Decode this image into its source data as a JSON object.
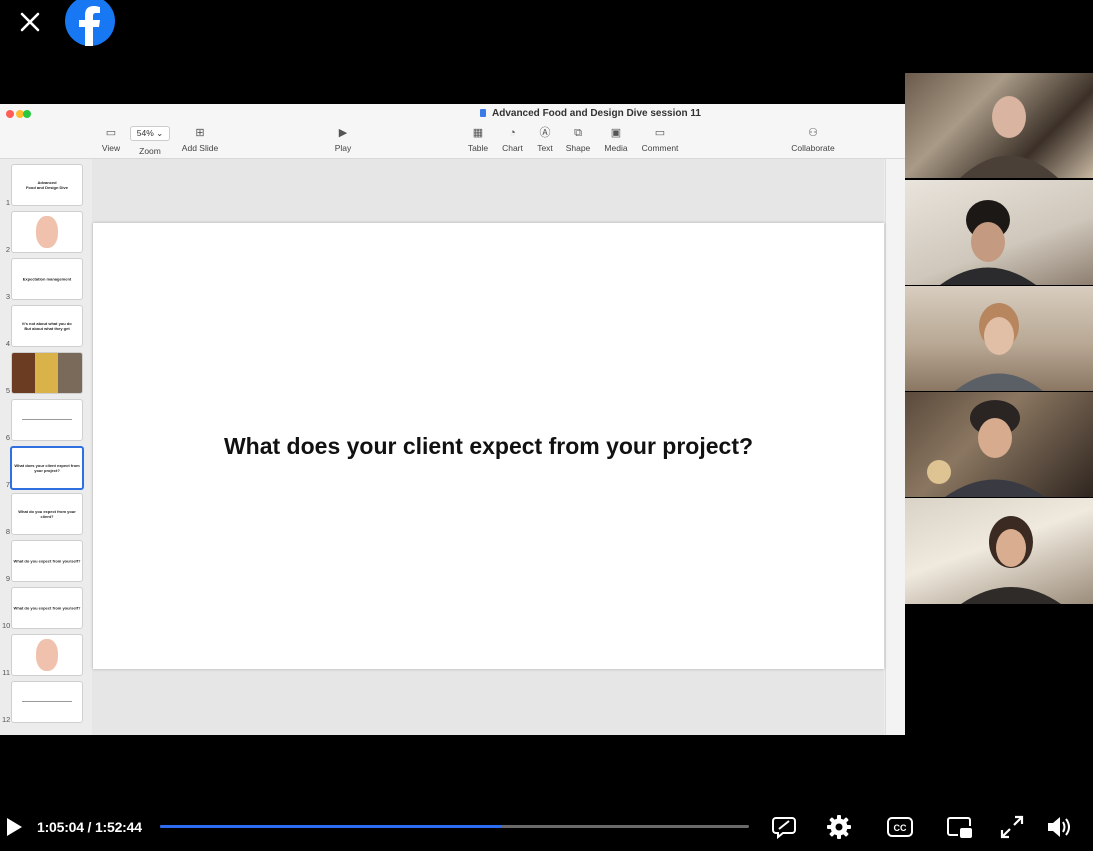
{
  "app": {
    "document_title": "Advanced Food and Design Dive session 11",
    "zoom": "54%",
    "toolbar": [
      {
        "name": "view",
        "label": "View",
        "icon": "sidebar-icon"
      },
      {
        "name": "zoom",
        "label": "Zoom",
        "icon": "zoom-icon"
      },
      {
        "name": "add-slide",
        "label": "Add Slide",
        "icon": "add-slide-icon"
      },
      {
        "name": "play",
        "label": "Play",
        "icon": "play-icon"
      },
      {
        "name": "table",
        "label": "Table",
        "icon": "table-icon"
      },
      {
        "name": "chart",
        "label": "Chart",
        "icon": "chart-icon"
      },
      {
        "name": "text",
        "label": "Text",
        "icon": "text-icon"
      },
      {
        "name": "shape",
        "label": "Shape",
        "icon": "shape-icon"
      },
      {
        "name": "media",
        "label": "Media",
        "icon": "media-icon"
      },
      {
        "name": "comment",
        "label": "Comment",
        "icon": "comment-icon"
      },
      {
        "name": "collaborate",
        "label": "Collaborate",
        "icon": "collaborate-icon"
      }
    ]
  },
  "slides": [
    {
      "num": "1",
      "text": "Advanced\nFood and Design Dive"
    },
    {
      "num": "2",
      "text": ""
    },
    {
      "num": "3",
      "text": "Expectation management"
    },
    {
      "num": "4",
      "text": "It's not about what you do\nBut about what they get"
    },
    {
      "num": "5",
      "text": ""
    },
    {
      "num": "6",
      "text": ""
    },
    {
      "num": "7",
      "text": "What does your client expect from your project?"
    },
    {
      "num": "8",
      "text": "What do you expect from your client?"
    },
    {
      "num": "9",
      "text": "What do you expect from yourself?"
    },
    {
      "num": "10",
      "text": "What do you expect from yourself?"
    },
    {
      "num": "11",
      "text": ""
    },
    {
      "num": "12",
      "text": ""
    }
  ],
  "selected_slide": 7,
  "current_slide": {
    "title": "What does your client expect from your project?"
  },
  "participants": [
    {
      "name": "participant-1"
    },
    {
      "name": "participant-2"
    },
    {
      "name": "participant-3"
    },
    {
      "name": "participant-4"
    },
    {
      "name": "participant-5"
    }
  ],
  "player": {
    "current_time": "1:05:04",
    "separator": " / ",
    "duration": "1:52:44",
    "progress": 0.58,
    "accent": "#2d6cf0"
  }
}
